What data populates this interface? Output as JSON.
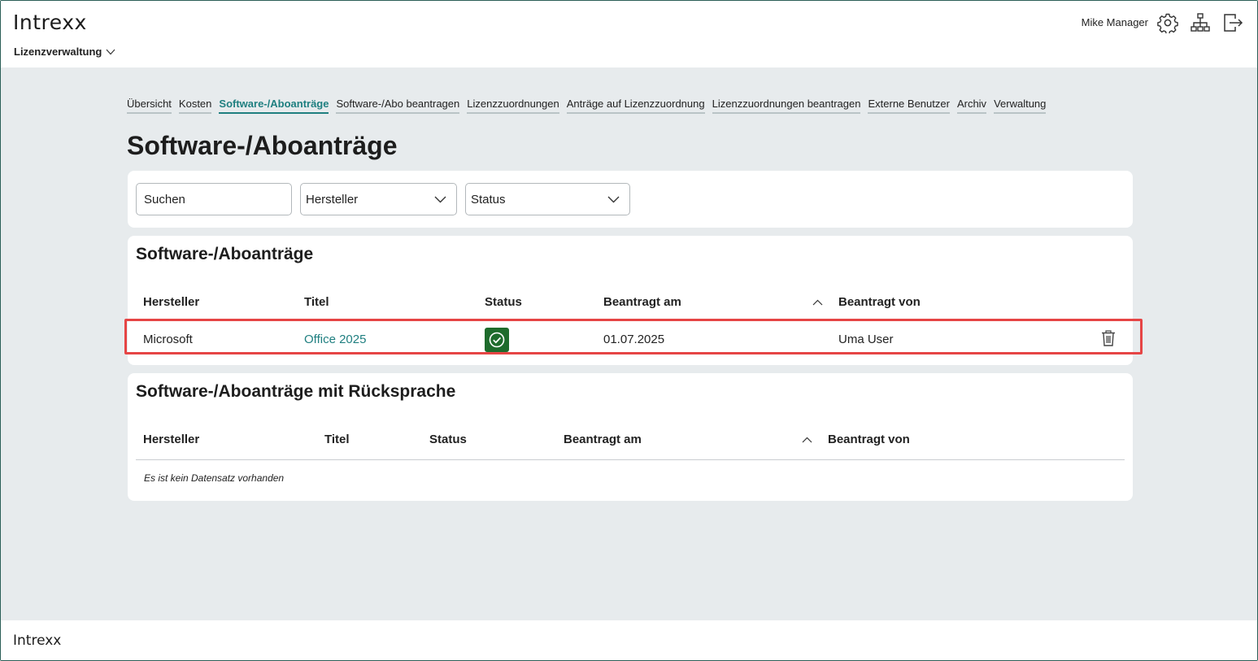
{
  "header": {
    "logo": "Intrexx",
    "app_name": "Lizenzverwaltung",
    "user_name": "Mike Manager",
    "icons": [
      "gear-icon",
      "sitemap-icon",
      "logout-icon"
    ]
  },
  "tabs": [
    {
      "label": "Übersicht",
      "active": false
    },
    {
      "label": "Kosten",
      "active": false
    },
    {
      "label": "Software-/Aboanträge",
      "active": true
    },
    {
      "label": "Software-/Abo beantragen",
      "active": false
    },
    {
      "label": "Lizenzzuordnungen",
      "active": false
    },
    {
      "label": "Anträge auf Lizenzzuordnung",
      "active": false
    },
    {
      "label": "Lizenzzuordnungen beantragen",
      "active": false
    },
    {
      "label": "Externe Benutzer",
      "active": false
    },
    {
      "label": "Archiv",
      "active": false
    },
    {
      "label": "Verwaltung",
      "active": false
    }
  ],
  "page_title": "Software-/Aboanträge",
  "filters": {
    "search_placeholder": "Suchen",
    "manufacturer_label": "Hersteller",
    "status_label": "Status"
  },
  "table1": {
    "title": "Software-/Aboanträge",
    "columns": [
      "Hersteller",
      "Titel",
      "Status",
      "Beantragt am",
      "Beantragt von"
    ],
    "rows": [
      {
        "hersteller": "Microsoft",
        "titel": "Office 2025",
        "status": "ok-icon",
        "beantragt_am": "01.07.2025",
        "beantragt_von": "Uma User"
      }
    ]
  },
  "table2": {
    "title": "Software-/Aboanträge mit Rücksprache",
    "columns": [
      "Hersteller",
      "Titel",
      "Status",
      "Beantragt am",
      "Beantragt von"
    ],
    "empty_text": "Es ist kein Datensatz vorhanden"
  },
  "footer": {
    "logo": "Intrexx"
  },
  "colors": {
    "accent": "#1f7f80",
    "status_ok": "#1e6b2c",
    "highlight": "#e64545",
    "background": "#e7ebed"
  }
}
